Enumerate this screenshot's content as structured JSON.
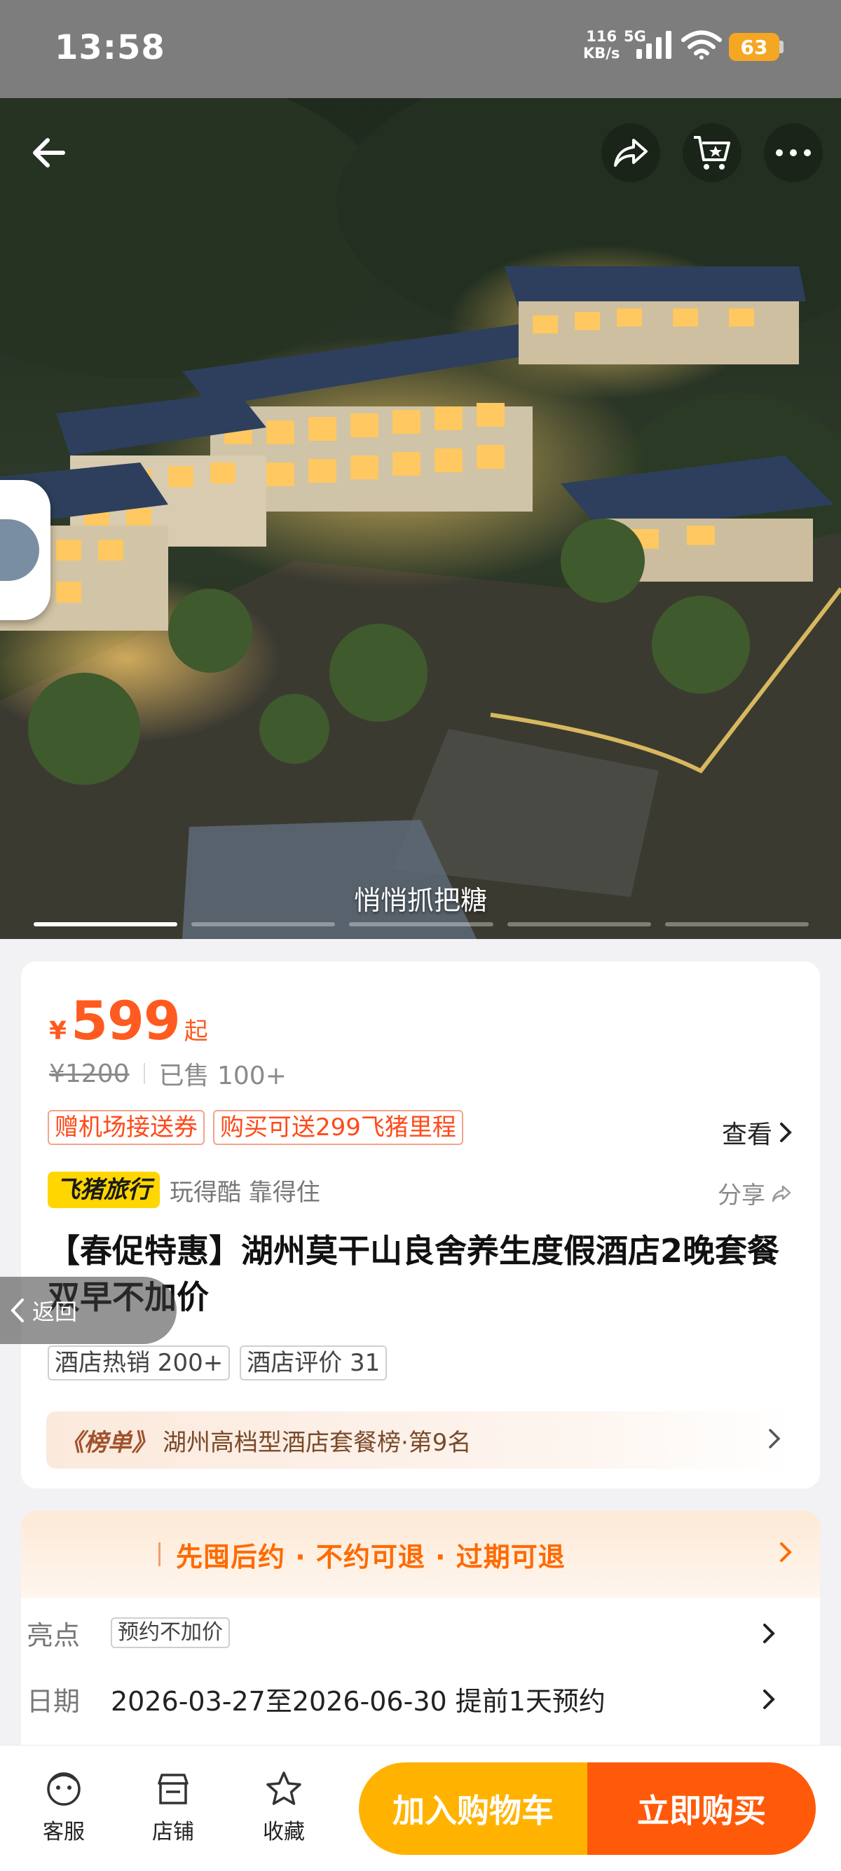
{
  "status_bar": {
    "time": "13:58",
    "net_speed_value": "116",
    "net_speed_unit": "KB/s",
    "signal_type": "5G",
    "battery": "63"
  },
  "hero": {
    "caption": "悄悄抓把糖",
    "image_count": 5,
    "active_image_index": 0
  },
  "product": {
    "currency": "¥",
    "price": "599",
    "price_suffix": "起",
    "original_price": "¥1200",
    "sold": "已售 100+",
    "coupons": [
      "赠机场接送券",
      "购买可送299飞猪里程"
    ],
    "view_label": "查看",
    "brand": "飞猪旅行",
    "slogan": "玩得酷 靠得住",
    "share_label": "分享",
    "title": "【春促特惠】湖州莫干山良舍养生度假酒店2晚套餐双早不加价",
    "tags": [
      "酒店热销 200+",
      "酒店评价 31"
    ],
    "rank_badge": "《榜单》",
    "rank_text": "湖州高档型酒店套餐榜·第9名"
  },
  "back_pill": {
    "label": "返回"
  },
  "policy": {
    "banner": "先囤后约 · 不约可退 · 过期可退",
    "highlight_label": "亮点",
    "highlight_tag": "预约不加价",
    "date_label": "日期",
    "date_value": "2026-03-27至2026-06-30 提前1天预约"
  },
  "bottom_bar": {
    "service": "客服",
    "shop": "店铺",
    "favorite": "收藏",
    "add_to_cart": "加入购物车",
    "buy_now": "立即购买"
  },
  "colors": {
    "price": "#ff5a1f",
    "cart_button": "#ffb300",
    "buy_button": "#ff5a0a",
    "brand_yellow": "#ffd600",
    "battery": "#f5a623"
  }
}
